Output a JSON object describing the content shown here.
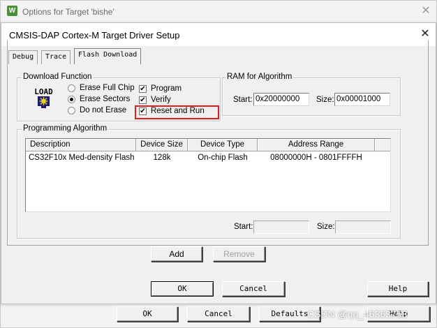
{
  "outer_window": {
    "logo_text": "W",
    "title": "Options for Target 'bishe'",
    "close_glyph": "✕",
    "buttons": {
      "ok": "OK",
      "cancel": "Cancel",
      "defaults": "Defaults",
      "help": "Help"
    }
  },
  "dialog": {
    "title": "CMSIS-DAP Cortex-M Target Driver Setup",
    "close_glyph": "✕",
    "tabs": [
      {
        "label": "Debug",
        "active": false
      },
      {
        "label": "Trace",
        "active": false
      },
      {
        "label": "Flash Download",
        "active": true
      }
    ]
  },
  "download_function": {
    "title": "Download Function",
    "icon_text": "LOAD",
    "radios": [
      {
        "label": "Erase Full Chip",
        "selected": false
      },
      {
        "label": "Erase Sectors",
        "selected": true
      },
      {
        "label": "Do not Erase",
        "selected": false
      }
    ],
    "checks": [
      {
        "label": "Program",
        "checked": true
      },
      {
        "label": "Verify",
        "checked": true
      },
      {
        "label": "Reset and Run",
        "checked": true
      }
    ],
    "check_glyph": "✔"
  },
  "ram": {
    "title": "RAM for Algorithm",
    "start_label": "Start:",
    "start_value": "0x20000000",
    "size_label": "Size:",
    "size_value": "0x00001000"
  },
  "programming": {
    "title": "Programming Algorithm",
    "columns": [
      "Description",
      "Device Size",
      "Device Type",
      "Address Range"
    ],
    "rows": [
      [
        "CS32F10x Med-density Flash",
        "128k",
        "On-chip Flash",
        "08000000H - 0801FFFFH"
      ]
    ],
    "start_label": "Start:",
    "start_value": "",
    "size_label": "Size:",
    "size_value": ""
  },
  "actions": {
    "add": "Add",
    "remove": "Remove"
  },
  "footer": {
    "ok": "OK",
    "cancel": "Cancel",
    "help": "Help"
  },
  "watermark": "CSDN @qq_46363758"
}
